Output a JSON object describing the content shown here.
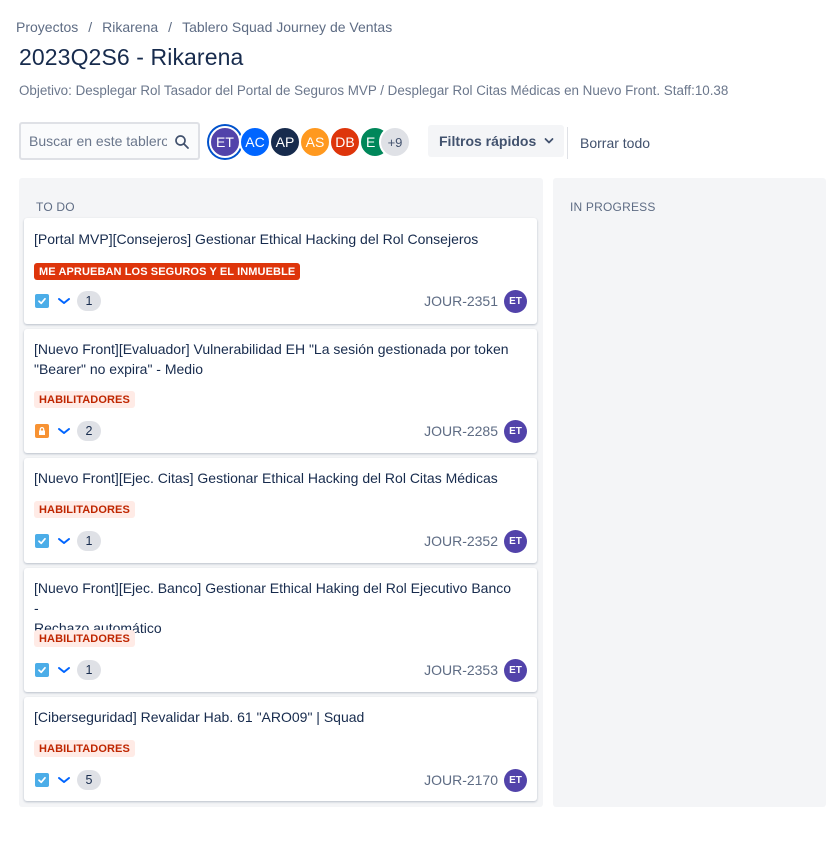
{
  "breadcrumb": {
    "items": [
      "Proyectos",
      "Rikarena",
      "Tablero Squad Journey de Ventas"
    ],
    "separator": "/"
  },
  "board": {
    "title": "2023Q2S6 - Rikarena",
    "objective": "Objetivo: Desplegar Rol Tasador del Portal de Seguros MVP / Desplegar Rol Citas Médicas en Nuevo Front. Staff:10.38"
  },
  "toolbar": {
    "search_placeholder": "Buscar en este tablero",
    "quick_filters_label": "Filtros rápidos",
    "clear_all_label": "Borrar todo"
  },
  "avatars": [
    {
      "initials": "ET",
      "color": "#5243aa",
      "selected": true
    },
    {
      "initials": "AC",
      "color": "#0065ff"
    },
    {
      "initials": "AP",
      "color": "#172b4d"
    },
    {
      "initials": "AS",
      "color": "#ff991f"
    },
    {
      "initials": "DB",
      "color": "#de350b"
    },
    {
      "initials": "E",
      "color": "#00875a"
    }
  ],
  "avatars_more": "+9",
  "columns": [
    {
      "title": "TO DO"
    },
    {
      "title": "IN PROGRESS"
    }
  ],
  "cards": [
    {
      "title": "[Portal MVP][Consejeros] Gestionar Ethical Hacking del Rol Consejeros",
      "label": "ME APRUEBAN LOS SEGUROS Y EL INMUEBLE",
      "label_style": "red",
      "type_icon": "task-checkbox-icon",
      "priority_icon": "priority-low-icon",
      "estimate": "1",
      "key": "JOUR-2351",
      "assignee": "ET"
    },
    {
      "title": "[Nuevo Front][Evaluador] Vulnerabilidad EH \"La sesión gestionada por token \"Bearer\" no expira\" - Medio",
      "title_line1": "[Nuevo Front][Evaluador] Vulnerabilidad EH \"La sesión gestionada por token",
      "title_line2": "\"Bearer\" no expira\" - Medio",
      "label": "HABILITADORES",
      "label_style": "light",
      "type_icon": "lock-icon",
      "priority_icon": "priority-low-icon",
      "estimate": "2",
      "key": "JOUR-2285",
      "assignee": "ET"
    },
    {
      "title": "[Nuevo Front][Ejec. Citas] Gestionar Ethical Hacking del Rol Citas Médicas",
      "label": "HABILITADORES",
      "label_style": "light",
      "type_icon": "task-checkbox-icon",
      "priority_icon": "priority-low-icon",
      "estimate": "1",
      "key": "JOUR-2352",
      "assignee": "ET"
    },
    {
      "title": "[Nuevo Front][Ejec. Banco] Gestionar Ethical Haking del Rol Ejecutivo Banco - Rechazo automático",
      "title_line1": "[Nuevo Front][Ejec. Banco] Gestionar Ethical Haking del Rol Ejecutivo Banco -",
      "title_line2": "Rechazo automático",
      "label": "HABILITADORES",
      "label_style": "light",
      "type_icon": "task-checkbox-icon",
      "priority_icon": "priority-low-icon",
      "estimate": "1",
      "key": "JOUR-2353",
      "assignee": "ET"
    },
    {
      "title": "[Ciberseguridad] Revalidar Hab. 61 \"ARO09\" | Squad",
      "label": "HABILITADORES",
      "label_style": "light",
      "type_icon": "task-checkbox-icon",
      "priority_icon": "priority-low-icon",
      "estimate": "5",
      "key": "JOUR-2170",
      "assignee": "ET"
    }
  ]
}
